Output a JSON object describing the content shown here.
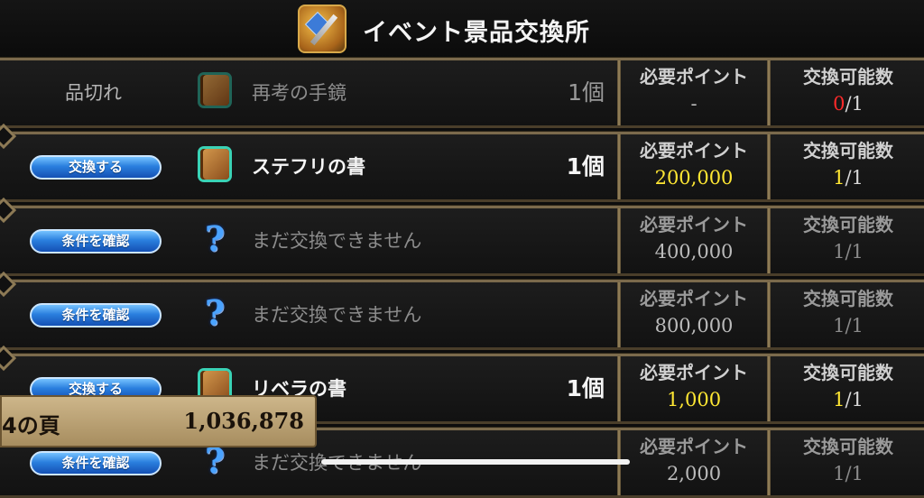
{
  "header": {
    "title": "イベント景品交換所"
  },
  "columns": {
    "points_label": "必要ポイント",
    "limit_label": "交換可能数"
  },
  "rows": [
    {
      "status": "品切れ",
      "icon": "book-icon",
      "name": "再考の手鏡",
      "qty": "1個",
      "points": "-",
      "limit_used": "0",
      "limit_total": "/1"
    },
    {
      "button": "交換する",
      "icon": "book-icon",
      "name": "ステフリの書",
      "qty": "1個",
      "points": "200,000",
      "limit_used": "1",
      "limit_total": "/1"
    },
    {
      "button": "条件を確認",
      "icon": "question-icon",
      "name": "まだ交換できません",
      "points": "400,000",
      "limit": "1/1"
    },
    {
      "button": "条件を確認",
      "icon": "question-icon",
      "name": "まだ交換できません",
      "points": "800,000",
      "limit": "1/1"
    },
    {
      "button": "交換する",
      "icon": "book-icon",
      "name": "リベラの書",
      "qty": "1個",
      "points": "1,000",
      "limit_used": "1",
      "limit_total": "/1"
    },
    {
      "button": "条件を確認",
      "icon": "question-icon",
      "name": "まだ交換できません",
      "points": "2,000",
      "limit": "1/1"
    }
  ],
  "overlay": {
    "label": "4の頁",
    "value": "1,036,878"
  },
  "colors": {
    "yellow": "#ffe733",
    "red": "#ff2a2a",
    "button_blue": "#2a7fde",
    "gold_border": "#7b6a4c"
  }
}
